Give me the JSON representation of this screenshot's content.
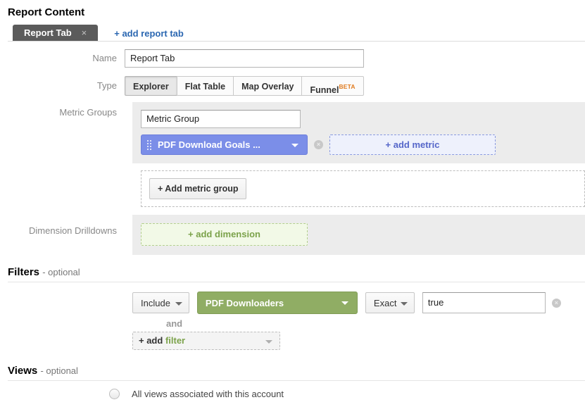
{
  "report_content": {
    "title": "Report Content",
    "tab": {
      "label": "Report Tab",
      "close": "×"
    },
    "add_report_tab": "+ add report tab",
    "name": {
      "label": "Name",
      "value": "Report Tab",
      "placeholder": "Report Tab"
    },
    "type": {
      "label": "Type",
      "options": [
        {
          "label": "Explorer",
          "active": true
        },
        {
          "label": "Flat Table",
          "active": false
        },
        {
          "label": "Map Overlay",
          "active": false
        },
        {
          "label": "Funnel",
          "badge": "BETA",
          "active": false
        }
      ]
    },
    "metric_groups": {
      "label": "Metric Groups",
      "group_name": {
        "value": "Metric Group",
        "placeholder": "Metric Group"
      },
      "metric_pill": "PDF Download Goals ...",
      "remove_icon": "×",
      "add_metric": "+ add metric",
      "add_metric_group": "+ Add metric group"
    },
    "dimension_drilldowns": {
      "label": "Dimension Drilldowns",
      "add_dimension": "+ add dimension"
    }
  },
  "filters": {
    "title": "Filters",
    "optional": "- optional",
    "include_select": "Include",
    "dimension_pill": "PDF Downloaders",
    "match_select": "Exact",
    "value": {
      "text": "true",
      "placeholder": ""
    },
    "clear_icon": "×",
    "and": "and",
    "add_filter": {
      "plus": "+ add ",
      "word": "filter"
    }
  },
  "views": {
    "title": "Views",
    "optional": "- optional",
    "all_views_label": "All views associated with this account"
  },
  "colors": {
    "metric_pill": "#7b8ee8",
    "filter_pill": "#90ad64",
    "link": "#2b67b1",
    "beta": "#e07b1f",
    "tab": "#5b5b5b"
  }
}
